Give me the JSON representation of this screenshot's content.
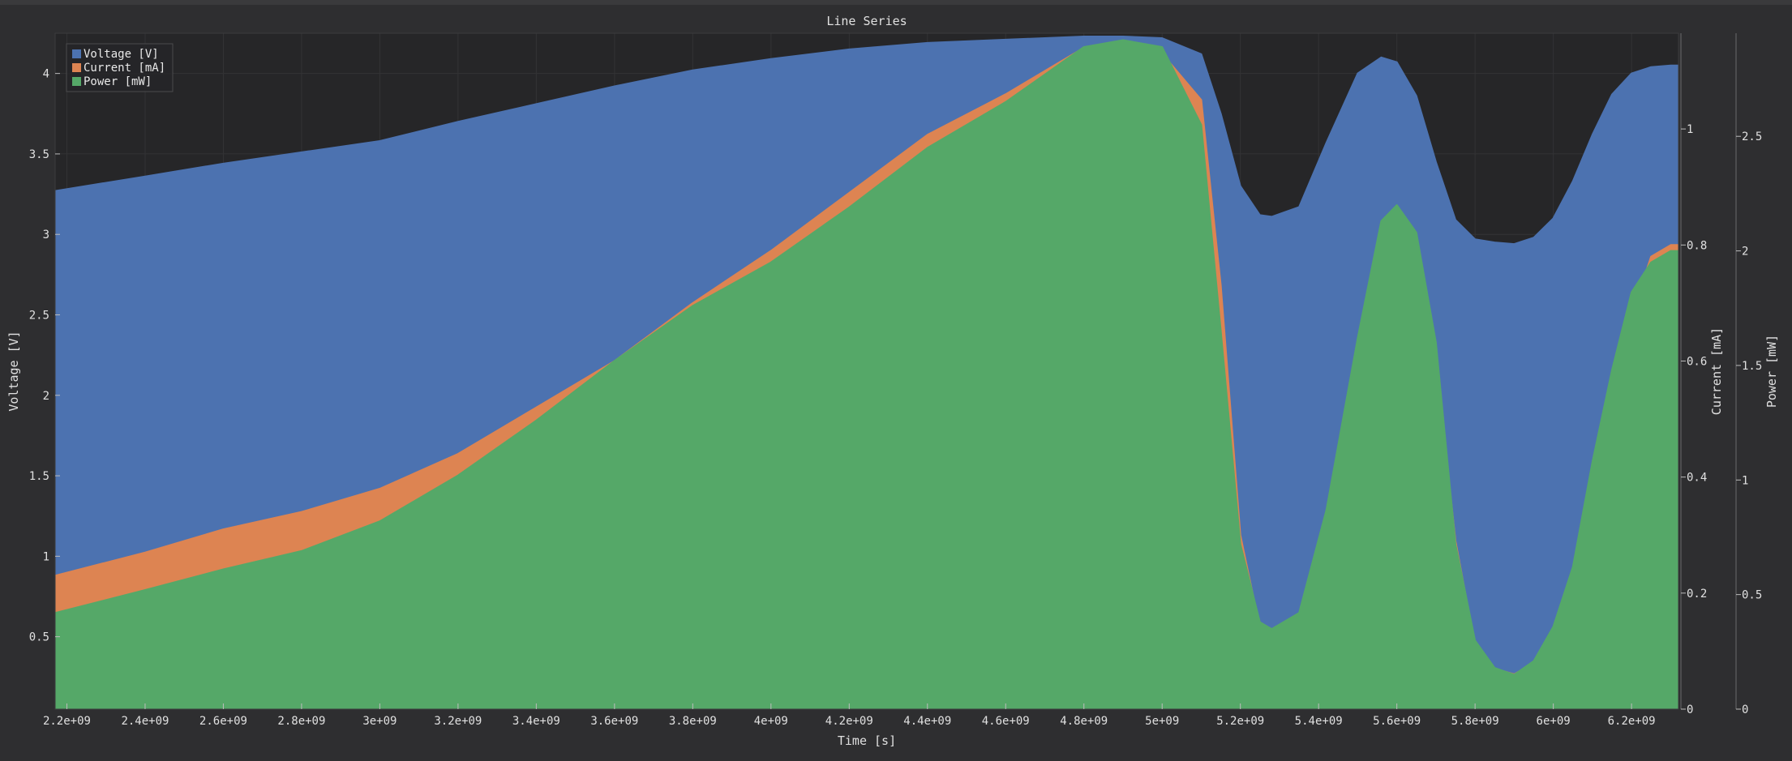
{
  "chart_data": {
    "type": "area",
    "title": "Line Series",
    "xlabel": "Time [s]",
    "xlim": [
      2170000000,
      6320000000
    ],
    "x_ticks": [
      2200000000,
      2400000000,
      2600000000,
      2800000000,
      3000000000,
      3200000000,
      3400000000,
      3600000000,
      3800000000,
      4000000000,
      4200000000,
      4400000000,
      4600000000,
      4800000000,
      5000000000,
      5200000000,
      5400000000,
      5600000000,
      5800000000,
      6000000000,
      6200000000
    ],
    "x_tick_labels": [
      "2.2e+09",
      "2.4e+09",
      "2.6e+09",
      "2.8e+09",
      "3e+09",
      "3.2e+09",
      "3.4e+09",
      "3.6e+09",
      "3.8e+09",
      "4e+09",
      "4.2e+09",
      "4.4e+09",
      "4.6e+09",
      "4.8e+09",
      "5e+09",
      "5.2e+09",
      "5.4e+09",
      "5.6e+09",
      "5.8e+09",
      "6e+09",
      "6.2e+09"
    ],
    "grid": true,
    "legend_position": "top-left",
    "axes": {
      "voltage": {
        "label": "Voltage [V]",
        "side": "left",
        "ylim": [
          0.05,
          4.25
        ],
        "ticks": [
          0.5,
          1,
          1.5,
          2,
          2.5,
          3,
          3.5,
          4
        ],
        "tick_labels": [
          "0.5",
          "1",
          "1.5",
          "2",
          "2.5",
          "3",
          "3.5",
          "4"
        ]
      },
      "current": {
        "label": "Current [mA]",
        "side": "right",
        "ylim": [
          0,
          1.165
        ],
        "ticks": [
          0,
          0.2,
          0.4,
          0.6,
          0.8,
          1
        ],
        "tick_labels": [
          "0",
          "0.2",
          "0.4",
          "0.6",
          "0.8",
          "1"
        ]
      },
      "power": {
        "label": "Power [mW]",
        "side": "right",
        "ylim": [
          0,
          2.95
        ],
        "ticks": [
          0,
          0.5,
          1,
          1.5,
          2,
          2.5
        ],
        "tick_labels": [
          "0",
          "0.5",
          "1",
          "1.5",
          "2",
          "2.5"
        ]
      }
    },
    "x": [
      2170000000,
      2400000000,
      2600000000,
      2800000000,
      3000000000,
      3200000000,
      3400000000,
      3600000000,
      3800000000,
      4000000000,
      4200000000,
      4400000000,
      4600000000,
      4800000000,
      4900000000,
      5000000000,
      5100000000,
      5150000000,
      5200000000,
      5250000000,
      5280000000,
      5350000000,
      5420000000,
      5500000000,
      5560000000,
      5600000000,
      5650000000,
      5700000000,
      5750000000,
      5800000000,
      5850000000,
      5900000000,
      5950000000,
      6000000000,
      6050000000,
      6100000000,
      6150000000,
      6200000000,
      6250000000,
      6300000000,
      6320000000
    ],
    "series": [
      {
        "name": "Voltage [V]",
        "axis": "voltage",
        "color": "#4c72b0",
        "values": [
          3.27,
          3.36,
          3.44,
          3.51,
          3.58,
          3.7,
          3.81,
          3.92,
          4.02,
          4.09,
          4.15,
          4.19,
          4.21,
          4.23,
          4.23,
          4.22,
          4.12,
          3.75,
          3.3,
          3.12,
          3.11,
          3.17,
          3.57,
          4.0,
          4.1,
          4.07,
          3.86,
          3.45,
          3.09,
          2.97,
          2.95,
          2.94,
          2.98,
          3.1,
          3.33,
          3.62,
          3.87,
          4.0,
          4.04,
          4.05,
          4.05
        ]
      },
      {
        "name": "Current [mA]",
        "axis": "current",
        "color": "#dd8452",
        "values": [
          0.23,
          0.27,
          0.31,
          0.34,
          0.38,
          0.44,
          0.52,
          0.6,
          0.7,
          0.79,
          0.89,
          0.99,
          1.06,
          1.14,
          1.15,
          1.13,
          1.05,
          0.73,
          0.3,
          0.14,
          0.13,
          0.15,
          0.32,
          0.59,
          0.82,
          0.86,
          0.81,
          0.6,
          0.29,
          0.11,
          0.07,
          0.06,
          0.08,
          0.13,
          0.22,
          0.36,
          0.53,
          0.68,
          0.78,
          0.8,
          0.8
        ]
      },
      {
        "name": "Power [mW]",
        "axis": "power",
        "color": "#55a868",
        "values": [
          0.42,
          0.52,
          0.61,
          0.69,
          0.82,
          1.02,
          1.26,
          1.52,
          1.76,
          1.95,
          2.19,
          2.45,
          2.65,
          2.89,
          2.92,
          2.89,
          2.55,
          1.65,
          0.72,
          0.38,
          0.35,
          0.42,
          0.87,
          1.62,
          2.13,
          2.2,
          2.08,
          1.6,
          0.72,
          0.3,
          0.18,
          0.15,
          0.21,
          0.36,
          0.62,
          1.08,
          1.48,
          1.82,
          1.95,
          2.0,
          2.0
        ]
      }
    ]
  }
}
